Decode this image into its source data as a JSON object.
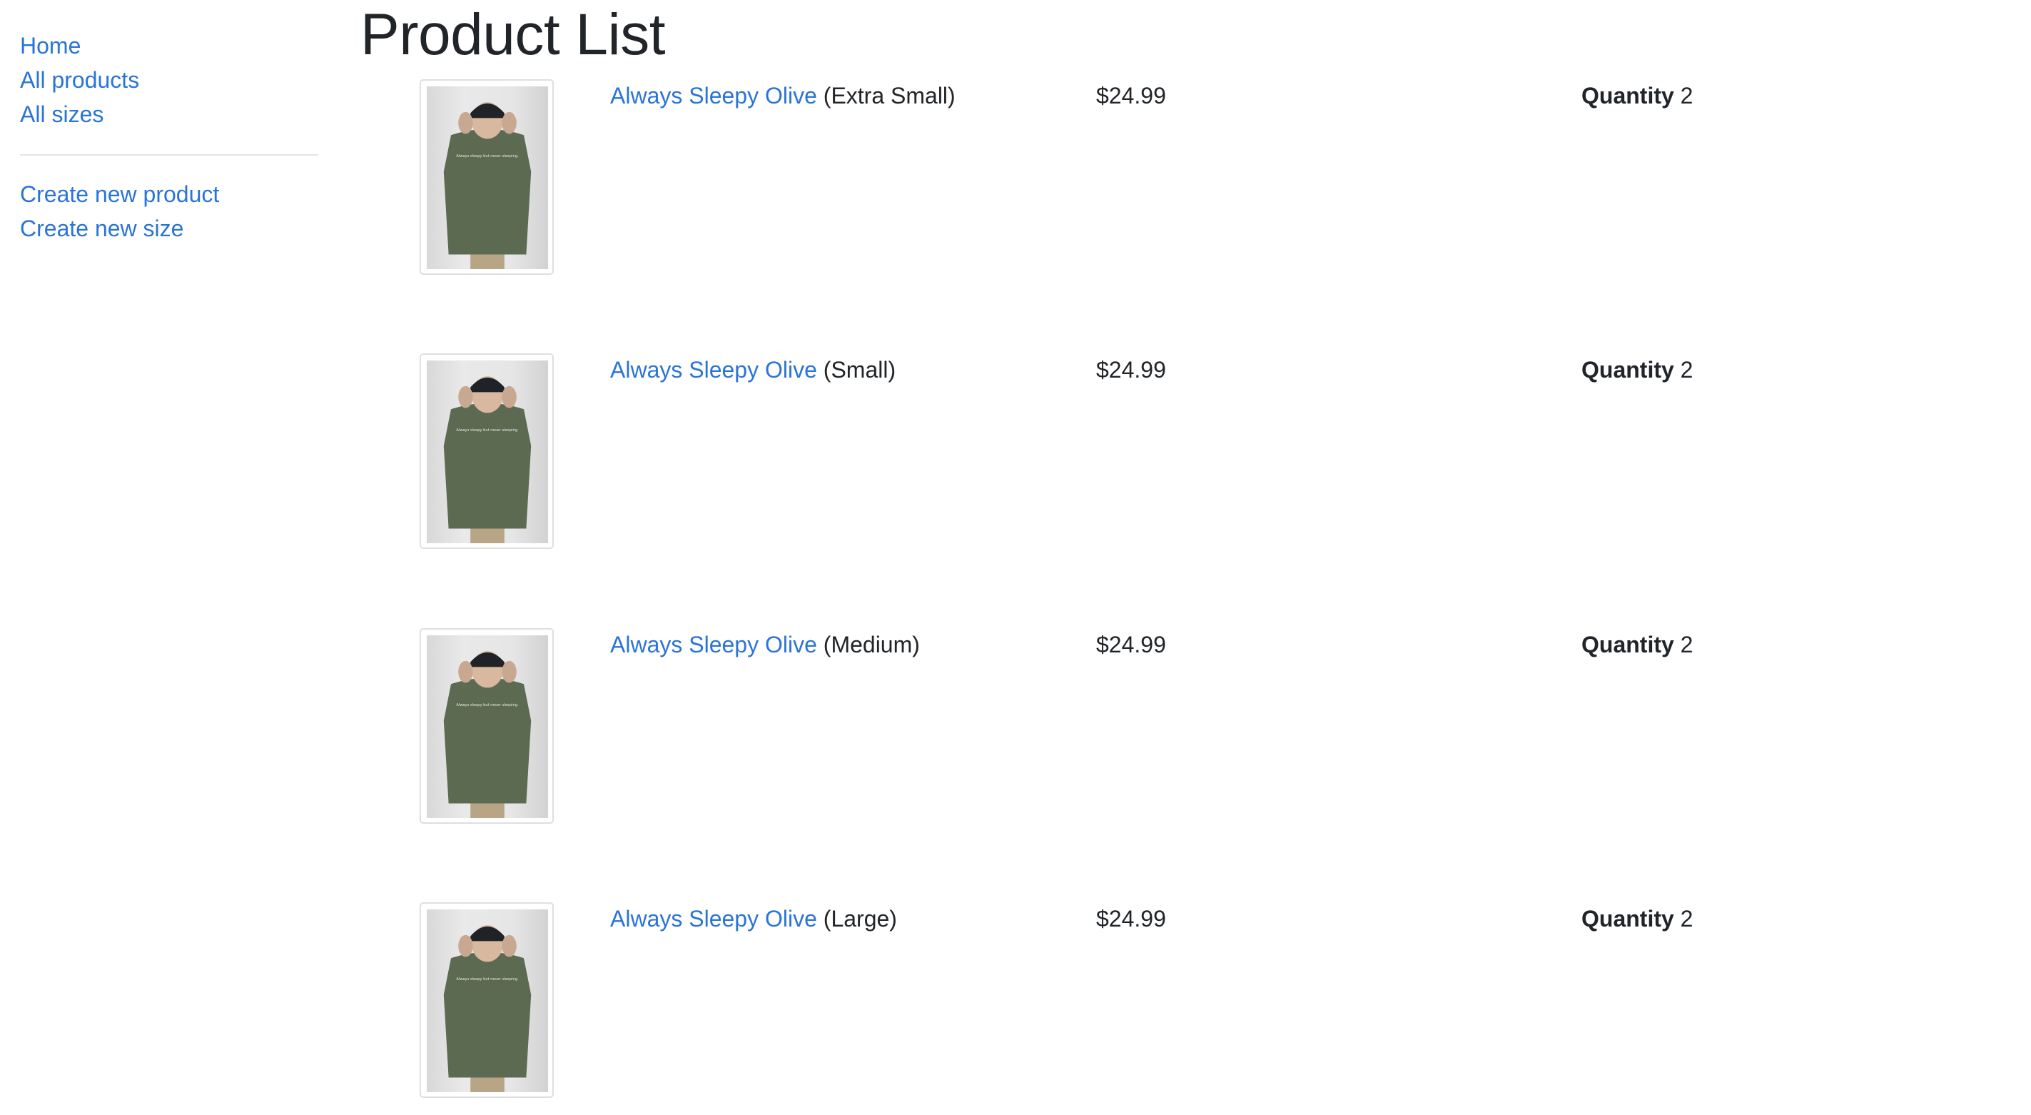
{
  "sidebar": {
    "nav_primary": [
      {
        "label": "Home"
      },
      {
        "label": "All products"
      },
      {
        "label": "All sizes"
      }
    ],
    "nav_secondary": [
      {
        "label": "Create new product"
      },
      {
        "label": "Create new size"
      }
    ]
  },
  "page": {
    "title": "Product List"
  },
  "products": [
    {
      "name": "Always Sleepy Olive",
      "size": "(Extra Small)",
      "price": "$24.99",
      "quantity_label": "Quantity",
      "quantity": "2",
      "shirt_print": "Always sleepy but never sleeping."
    },
    {
      "name": "Always Sleepy Olive",
      "size": "(Small)",
      "price": "$24.99",
      "quantity_label": "Quantity",
      "quantity": "2",
      "shirt_print": "Always sleepy but never sleeping."
    },
    {
      "name": "Always Sleepy Olive",
      "size": "(Medium)",
      "price": "$24.99",
      "quantity_label": "Quantity",
      "quantity": "2",
      "shirt_print": "Always sleepy but never sleeping."
    },
    {
      "name": "Always Sleepy Olive",
      "size": "(Large)",
      "price": "$24.99",
      "quantity_label": "Quantity",
      "quantity": "2",
      "shirt_print": "Always sleepy but never sleeping."
    }
  ],
  "colors": {
    "link": "#2a74d8",
    "text": "#212529",
    "shirt": "#5d6a52",
    "cap": "#1f2226",
    "pants": "#b7a585"
  }
}
